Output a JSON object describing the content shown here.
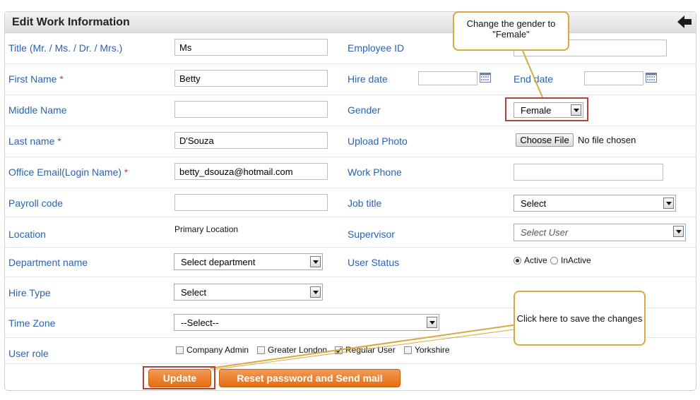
{
  "header": {
    "title": "Edit Work Information"
  },
  "fields": {
    "title": {
      "label": "Title (Mr. / Ms. / Dr. / Mrs.)",
      "value": "Ms"
    },
    "first_name": {
      "label": "First Name",
      "required": "*",
      "value": "Betty"
    },
    "middle_name": {
      "label": "Middle Name",
      "value": ""
    },
    "last_name": {
      "label": "Last name",
      "required": "*",
      "value": "D'Souza"
    },
    "office_email": {
      "label": "Office Email(Login Name)",
      "required": "*",
      "value": "betty_dsouza@hotmail.com"
    },
    "payroll_code": {
      "label": "Payroll code",
      "value": ""
    },
    "location": {
      "label": "Location",
      "value": "Primary Location"
    },
    "department": {
      "label": "Department name",
      "value": "Select department"
    },
    "hire_type": {
      "label": "Hire Type",
      "value": "Select"
    },
    "time_zone": {
      "label": "Time Zone",
      "value": "--Select--"
    },
    "user_role": {
      "label": "User role",
      "options": [
        {
          "label": "Company Admin",
          "checked": false
        },
        {
          "label": "Greater London",
          "checked": false
        },
        {
          "label": "Regular User",
          "checked": true
        },
        {
          "label": "Yorkshire",
          "checked": false
        }
      ]
    },
    "employee_id": {
      "label": "Employee ID",
      "value": ""
    },
    "hire_date": {
      "label": "Hire date",
      "value": ""
    },
    "end_date": {
      "label": "End date",
      "value": ""
    },
    "gender": {
      "label": "Gender",
      "value": "Female"
    },
    "upload_photo": {
      "label": "Upload Photo",
      "button": "Choose File",
      "status": "No file chosen"
    },
    "work_phone": {
      "label": "Work Phone",
      "value": ""
    },
    "job_title": {
      "label": "Job title",
      "value": "Select"
    },
    "supervisor": {
      "label": "Supervisor",
      "placeholder": "Select User"
    },
    "user_status": {
      "label": "User Status",
      "options": [
        {
          "label": "Active",
          "selected": true
        },
        {
          "label": "InActive",
          "selected": false
        }
      ]
    }
  },
  "buttons": {
    "update": "Update",
    "reset": "Reset password and Send mail"
  },
  "callouts": {
    "gender": "Change the gender to \"Female\"",
    "save": "Click here to save the changes"
  },
  "colors": {
    "label": "#2a63b0",
    "accent": "#e56d12",
    "highlight": "#b3433a",
    "callout_border": "#d8a93e"
  }
}
